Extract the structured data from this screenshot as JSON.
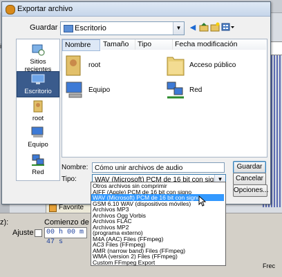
{
  "background": {
    "favorites_label": "Favorite",
    "comienzo_label": "Comienzo de la se",
    "ajuste_label": "Ajuste a",
    "time_value": "00 h 00 m 47 s",
    "left_fragment_1": "ices",
    "left_fragment_2": "z):",
    "right_fragment": "Frec"
  },
  "dialog": {
    "title": "Exportar archivo",
    "save_in_label": "Guardar en:",
    "save_in_value": "Escritorio",
    "sidebar": [
      {
        "label": "Sitios recientes",
        "icon": "recent-places-icon"
      },
      {
        "label": "Escritorio",
        "icon": "desktop-icon"
      },
      {
        "label": "root",
        "icon": "user-folder-icon"
      },
      {
        "label": "Equipo",
        "icon": "computer-icon"
      },
      {
        "label": "Red",
        "icon": "network-icon"
      }
    ],
    "columns": [
      "Nombre",
      "Tamaño",
      "Tipo",
      "Fecha modificación"
    ],
    "files": [
      {
        "name": "root",
        "icon": "user-folder-icon"
      },
      {
        "name": "Acceso público",
        "icon": "folder-icon"
      },
      {
        "name": "Equipo",
        "icon": "computer-icon"
      },
      {
        "name": "Red",
        "icon": "network-icon"
      }
    ],
    "name_label": "Nombre:",
    "name_value": "Cómo unir archivos de audio",
    "type_label": "Tipo:",
    "type_value": "WAV (Microsoft) PCM de 16 bit con signo",
    "save_button": "Guardar",
    "cancel_button": "Cancelar",
    "options_button": "Opciones...",
    "type_options": [
      "Otros archivos sin comprimir",
      "AIFF (Apple) PCM de 16 bit con signo",
      "WAV (Microsoft) PCM de 16 bit con signo",
      "GSM 6.10 WAV (dispositivos móviles)",
      "Archivos MP3",
      "Archivos Ogg Vorbis",
      "Archivos FLAC",
      "Archivos MP2",
      "(programa externo)",
      "M4A (AAC) Files (FFmpeg)",
      "AC3 Files (FFmpeg)",
      "AMR (narrow band) Files (FFmpeg)",
      "WMA (version 2) Files (FFmpeg)",
      "Custom FFmpeg Export"
    ],
    "selected_option_index": 2
  },
  "colors": {
    "selection": "#3399ff",
    "sidebar_active": "#3a5b8c"
  }
}
